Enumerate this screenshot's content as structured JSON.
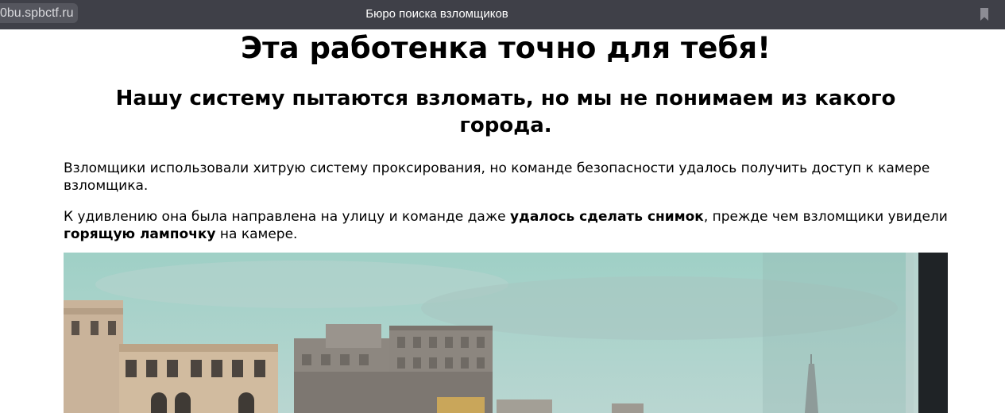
{
  "browser": {
    "url": "0bu.spbctf.ru",
    "tab_title": "Бюро поиска взломщиков",
    "bookmark_icon": "bookmark-icon"
  },
  "page": {
    "title": "Эта работенка точно для тебя!",
    "subtitle": "Нашу систему пытаются взломать, но мы не понимаем из какого города.",
    "paragraph1": "Взломщики использовали хитрую систему проксирования, но команде безопасности удалось получить доступ к камере взломщика.",
    "paragraph2": {
      "part1": "К удивлению она была направлена на улицу и команде даже ",
      "bold1": "удалось сделать снимок",
      "part2": ", прежде чем взломщики увидели ",
      "bold2": "горящую лампочку",
      "part3": " на камере."
    }
  },
  "colors": {
    "topbar": "#3f4048",
    "sky": "#a9cfc8",
    "window_frame": "#1f2326"
  }
}
